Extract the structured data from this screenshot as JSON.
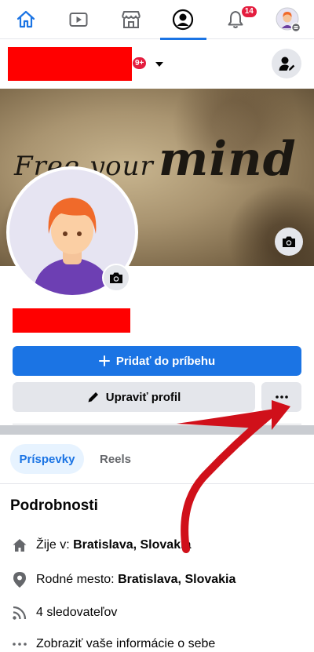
{
  "nav": {
    "notifications_badge": "14",
    "items": [
      "home-icon",
      "video-icon",
      "marketplace-icon",
      "profile-icon",
      "notifications-icon",
      "menu-avatar-icon"
    ]
  },
  "header": {
    "notifications_pill": "9+"
  },
  "cover": {
    "text_small": "Free your",
    "text_big": "mind"
  },
  "actions": {
    "add_story": "Pridať do príbehu",
    "edit_profile": "Upraviť profil",
    "more": "…"
  },
  "tabs": {
    "posts": "Príspevky",
    "reels": "Reels"
  },
  "details": {
    "title": "Podrobnosti",
    "lives_prefix": "Žije v: ",
    "lives_value": "Bratislava, Slovakia",
    "hometown_prefix": "Rodné mesto: ",
    "hometown_value": "Bratislava, Slovakia",
    "followers": "4 sledovateľov",
    "about": "Zobraziť vaše informácie o sebe"
  },
  "colors": {
    "accent": "#1b74e4",
    "badge": "#e41e3f",
    "redaction": "#ff0000",
    "arrow": "#d0101a"
  }
}
